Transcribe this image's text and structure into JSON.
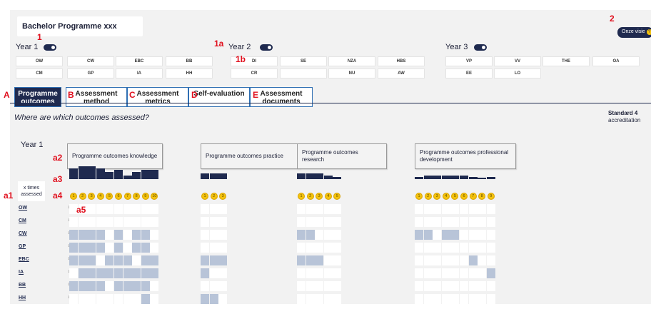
{
  "header": {
    "title": "Bachelor Programme xxx",
    "onze_label": "Onze visie",
    "onze_icon": "?"
  },
  "markers": {
    "m1": "1",
    "m1a": "1a",
    "m1b": "1b",
    "m2": "2",
    "A": "A",
    "B": "B",
    "C": "C",
    "D": "D",
    "E": "E",
    "a1": "a1",
    "a2": "a2",
    "a3": "a3",
    "a4": "a4",
    "a5": "a5"
  },
  "years": [
    {
      "label": "Year 1"
    },
    {
      "label": "Year 2"
    },
    {
      "label": "Year 3"
    }
  ],
  "courses": {
    "y1r1": [
      "OW",
      "CW",
      "EBC",
      "BB"
    ],
    "y1r2": [
      "CM",
      "GP",
      "IA",
      "HH"
    ],
    "y2r1": [
      "DI",
      "SE",
      "NZA",
      "HBS"
    ],
    "y2r2": [
      "CR",
      "",
      "NU",
      "AW"
    ],
    "y3r1": [
      "VP",
      "VV",
      "THE",
      "OA"
    ],
    "y3r2": [
      "EE",
      "LO"
    ]
  },
  "tabs": [
    {
      "label": "Programme outcomes"
    },
    {
      "label": "Assessment method"
    },
    {
      "label": "Assessment metrics"
    },
    {
      "label": "Self-evaluation"
    },
    {
      "label": "Assessment documents"
    }
  ],
  "question": "Where are which outcomes assessed?",
  "standard": {
    "title": "Standard 4",
    "sub": "accreditation"
  },
  "matrix": {
    "year_label": "Year 1",
    "xtimes_label": "x times assessed",
    "groups": [
      {
        "label": "Programme outcomes knowledge",
        "outcomes": [
          "1",
          "2",
          "3",
          "4",
          "5",
          "6",
          "7",
          "8",
          "9",
          "10"
        ],
        "counts": [
          6,
          7,
          7,
          6,
          4,
          5,
          2,
          4,
          5,
          5
        ]
      },
      {
        "label": "Programme outcomes practice",
        "outcomes": [
          "1",
          "2",
          "3"
        ],
        "counts": [
          3,
          3,
          3
        ]
      },
      {
        "label": "Programme outcomes research",
        "outcomes": [
          "1",
          "2",
          "3",
          "4",
          "5"
        ],
        "counts": [
          3,
          3,
          3,
          2,
          1
        ]
      },
      {
        "label": "Programme outcomes professional development",
        "outcomes": [
          "1",
          "2",
          "3",
          "4",
          "5",
          "6",
          "7",
          "8",
          "9"
        ],
        "counts": [
          1,
          2,
          2,
          2,
          2,
          2,
          1,
          0,
          1
        ]
      }
    ],
    "rows": [
      {
        "label": "OW",
        "cells": [
          [
            0,
            0,
            0,
            0,
            0,
            0,
            0,
            0,
            0,
            0
          ],
          [
            0,
            0,
            0
          ],
          [
            0,
            0,
            0,
            0,
            0
          ],
          [
            0,
            0,
            0,
            0,
            0,
            0,
            0,
            0,
            0
          ]
        ]
      },
      {
        "label": "CM",
        "cells": [
          [
            0,
            0,
            0,
            0,
            0,
            0,
            0,
            0,
            0,
            0
          ],
          [
            0,
            0,
            0
          ],
          [
            0,
            0,
            0,
            0,
            0
          ],
          [
            0,
            0,
            0,
            0,
            0,
            0,
            0,
            0,
            0
          ]
        ]
      },
      {
        "label": "CW",
        "cells": [
          [
            1,
            1,
            1,
            1,
            0,
            1,
            0,
            1,
            1,
            0
          ],
          [
            0,
            0,
            0
          ],
          [
            1,
            1,
            0,
            0,
            0
          ],
          [
            1,
            1,
            0,
            1,
            1,
            0,
            0,
            0,
            0
          ]
        ]
      },
      {
        "label": "GP",
        "cells": [
          [
            1,
            1,
            1,
            1,
            0,
            1,
            0,
            1,
            1,
            0
          ],
          [
            0,
            0,
            0
          ],
          [
            0,
            0,
            0,
            0,
            0
          ],
          [
            0,
            0,
            0,
            0,
            0,
            0,
            0,
            0,
            0
          ]
        ]
      },
      {
        "label": "EBC",
        "cells": [
          [
            1,
            1,
            1,
            0,
            1,
            1,
            1,
            0,
            1,
            1
          ],
          [
            1,
            1,
            1
          ],
          [
            1,
            1,
            1,
            0,
            0
          ],
          [
            0,
            0,
            0,
            0,
            0,
            0,
            1,
            0,
            0
          ]
        ]
      },
      {
        "label": "IA",
        "cells": [
          [
            0,
            1,
            1,
            1,
            1,
            1,
            1,
            1,
            1,
            1
          ],
          [
            1,
            0,
            0
          ],
          [
            0,
            0,
            0,
            0,
            0
          ],
          [
            0,
            0,
            0,
            0,
            0,
            0,
            0,
            0,
            1
          ]
        ]
      },
      {
        "label": "BB",
        "cells": [
          [
            1,
            1,
            1,
            1,
            0,
            1,
            1,
            1,
            1,
            0
          ],
          [
            0,
            0,
            0
          ],
          [
            0,
            0,
            0,
            0,
            0
          ],
          [
            0,
            0,
            0,
            0,
            0,
            0,
            0,
            0,
            0
          ]
        ]
      },
      {
        "label": "HH",
        "cells": [
          [
            0,
            0,
            0,
            0,
            0,
            0,
            0,
            0,
            1,
            0
          ],
          [
            1,
            1,
            0
          ],
          [
            0,
            0,
            0,
            0,
            0
          ],
          [
            0,
            0,
            0,
            0,
            0,
            0,
            0,
            0,
            0
          ]
        ]
      }
    ]
  }
}
